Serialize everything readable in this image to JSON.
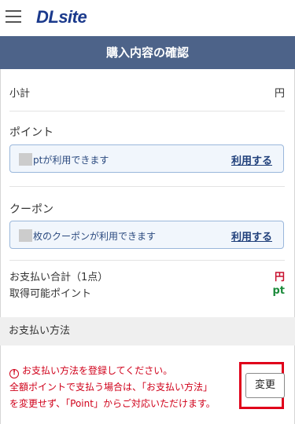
{
  "header": {
    "logo_text": "DLsite",
    "menu_icon": "hamburger-menu-icon"
  },
  "page_title": "購入内容の確認",
  "subtotal": {
    "label": "小計",
    "value": "円"
  },
  "points": {
    "label": "ポイント",
    "available_text": "ptが利用できます",
    "use_label": "利用する"
  },
  "coupon": {
    "label": "クーポン",
    "available_text": "枚のクーポンが利用できます",
    "use_label": "利用する"
  },
  "totals": {
    "payment_total_label": "お支払い合計（1点）",
    "payment_total_value": "円",
    "earnable_points_label": "取得可能ポイント",
    "earnable_points_value": "pt"
  },
  "payment_method": {
    "header": "お支払い方法",
    "warning_icon": "exclamation-circle-icon",
    "warning_line1": "お支払い方法を登録してください。",
    "warning_line2": "全額ポイントで支払う場合は、「お支払い方法」",
    "warning_line3": "を変更せず、「Point」からご対応いただけます。",
    "change_label": "変更"
  },
  "colors": {
    "title_bar": "#4d6389",
    "brand": "#1b3a8c",
    "warning": "#d0021b",
    "price": "#c8102e",
    "points": "#1b8a3a",
    "highlight": "#e0001a"
  }
}
